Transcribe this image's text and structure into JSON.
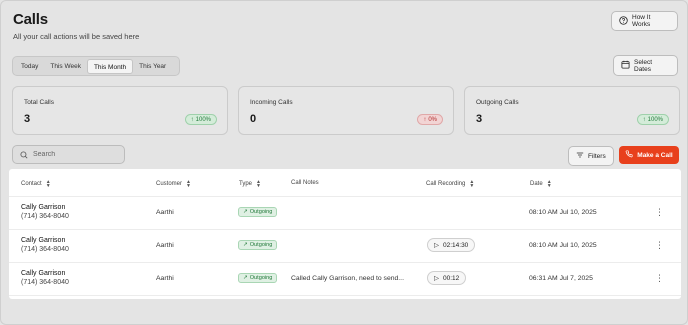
{
  "header": {
    "title": "Calls",
    "subtitle": "All your call actions will be saved here",
    "how_it_works_label": "How It Works"
  },
  "period_tabs": [
    {
      "label": "Today",
      "active": false
    },
    {
      "label": "This Week",
      "active": false
    },
    {
      "label": "This Month",
      "active": true
    },
    {
      "label": "This Year",
      "active": false
    }
  ],
  "select_dates_label": "Select Dates",
  "stats": [
    {
      "label": "Total Calls",
      "value": "3",
      "change": "100%",
      "direction": "up",
      "color": "#237a3b"
    },
    {
      "label": "Incoming Calls",
      "value": "0",
      "change": "0%",
      "direction": "up",
      "color": "#b12b2b"
    },
    {
      "label": "Outgoing Calls",
      "value": "3",
      "change": "100%",
      "direction": "up",
      "color": "#237a3b"
    }
  ],
  "search": {
    "placeholder": "Search"
  },
  "filters_label": "Filters",
  "make_call_label": "Make a Call",
  "accent_color": "#e8401c",
  "table": {
    "columns": [
      "Contact",
      "Customer",
      "Type",
      "Call Notes",
      "Call Recording",
      "Date"
    ],
    "rows": [
      {
        "contact_name": "Cally Garrison",
        "contact_phone": "(714) 364-8040",
        "customer": "Aarthi",
        "type": "Outgoing",
        "notes": "",
        "recording": "",
        "date": "08:10 AM Jul 10, 2025"
      },
      {
        "contact_name": "Cally Garrison",
        "contact_phone": "(714) 364-8040",
        "customer": "Aarthi",
        "type": "Outgoing",
        "notes": "",
        "recording": "02:14:30",
        "date": "08:10 AM Jul 10, 2025"
      },
      {
        "contact_name": "Cally Garrison",
        "contact_phone": "(714) 364-8040",
        "customer": "Aarthi",
        "type": "Outgoing",
        "notes": "Called Cally Garrison, need to send...",
        "recording": "00:12",
        "date": "06:31 AM Jul 7, 2025"
      }
    ]
  },
  "icons": {
    "help": "help-circle-icon",
    "calendar": "calendar-icon",
    "search": "search-icon",
    "filter": "filter-icon",
    "phone": "phone-icon",
    "arrow_up": "arrow-up-icon",
    "outgoing": "outgoing-arrow-icon",
    "play": "play-icon",
    "more": "more-vertical-icon",
    "sort": "sort-icon"
  }
}
